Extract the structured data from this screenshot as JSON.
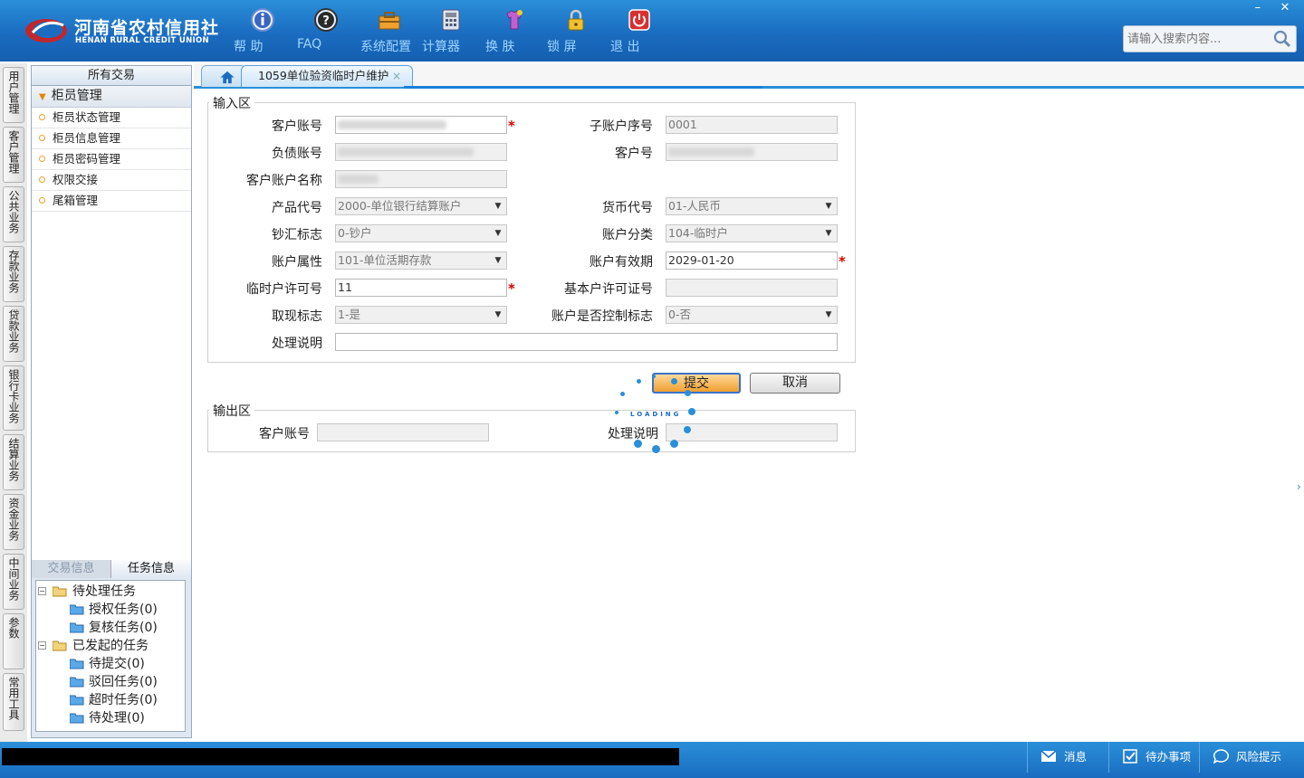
{
  "app": {
    "logo_cn": "河南省农村信用社",
    "logo_en": "HENAN RURAL CREDIT UNION"
  },
  "toolbar": [
    {
      "label": "帮 助",
      "icon": "info-icon"
    },
    {
      "label": "FAQ",
      "icon": "faq-icon"
    },
    {
      "label": "系统配置",
      "icon": "settings-toolbox-icon"
    },
    {
      "label": "计算器",
      "icon": "calculator-icon"
    },
    {
      "label": "换 肤",
      "icon": "skin-icon"
    },
    {
      "label": "锁 屏",
      "icon": "lock-icon"
    },
    {
      "label": "退 出",
      "icon": "power-icon"
    }
  ],
  "window_controls": {
    "minimize": "–",
    "close": "✕"
  },
  "search": {
    "placeholder": "请输入搜索内容..."
  },
  "vtabs": [
    "用户管理",
    "客户管理",
    "公共业务",
    "存款业务",
    "贷款业务",
    "银行卡业务",
    "结算业务",
    "资金业务",
    "中间业务",
    "参数",
    "常用工具"
  ],
  "left_panel": {
    "header": "所有交易",
    "group": "柜员管理",
    "items": [
      "柜员状态管理",
      "柜员信息管理",
      "柜员密码管理",
      "权限交接",
      "尾箱管理"
    ],
    "bottom_tabs": [
      "交易信息",
      "任务信息"
    ],
    "tree": [
      {
        "label": "待处理任务",
        "level": 0
      },
      {
        "label": "授权任务(0)",
        "level": 1
      },
      {
        "label": "复核任务(0)",
        "level": 1
      },
      {
        "label": "已发起的任务",
        "level": 0
      },
      {
        "label": "待提交(0)",
        "level": 1
      },
      {
        "label": "驳回任务(0)",
        "level": 1
      },
      {
        "label": "超时任务(0)",
        "level": 1
      },
      {
        "label": "待处理(0)",
        "level": 1
      }
    ]
  },
  "tabs": {
    "active": "1059单位验资临时户维护",
    "close": "×"
  },
  "form": {
    "input_legend": "输入区",
    "output_legend": "输出区",
    "fields": {
      "customer_account": {
        "label": "客户账号",
        "value": ""
      },
      "sub_account_seq": {
        "label": "子账户序号",
        "value": "0001"
      },
      "debt_account": {
        "label": "负债账号",
        "value": ""
      },
      "customer_no": {
        "label": "客户号",
        "value": ""
      },
      "account_name": {
        "label": "客户账户名称",
        "value": ""
      },
      "product_code": {
        "label": "产品代号",
        "value": "2000-单位银行结算账户"
      },
      "currency": {
        "label": "货币代号",
        "value": "01-人民币"
      },
      "cash_flag": {
        "label": "钞汇标志",
        "value": "0-钞户"
      },
      "account_class": {
        "label": "账户分类",
        "value": "104-临时户"
      },
      "account_attr": {
        "label": "账户属性",
        "value": "101-单位活期存款"
      },
      "validity": {
        "label": "账户有效期",
        "value": "2029-01-20"
      },
      "temp_permit": {
        "label": "临时户许可号",
        "value": "11"
      },
      "basic_permit": {
        "label": "基本户许可证号",
        "value": ""
      },
      "withdraw_flag": {
        "label": "取现标志",
        "value": "1-是"
      },
      "control_flag": {
        "label": "账户是否控制标志",
        "value": "0-否"
      },
      "remark": {
        "label": "处理说明",
        "value": ""
      }
    },
    "output": {
      "customer_account": {
        "label": "客户账号",
        "value": ""
      },
      "remark": {
        "label": "处理说明",
        "value": ""
      }
    },
    "submit": "提交",
    "cancel": "取消",
    "loading": "LOADING",
    "required_mark": "*"
  },
  "statusbar": [
    {
      "label": "消息",
      "icon": "mail-icon"
    },
    {
      "label": "待办事项",
      "icon": "checkbox-icon"
    },
    {
      "label": "风险提示",
      "icon": "chat-icon"
    }
  ],
  "colors": {
    "topbar": "#1a6cc0",
    "accent": "#2a8fd8",
    "required": "#dd0000",
    "submit": "#f0a030"
  }
}
